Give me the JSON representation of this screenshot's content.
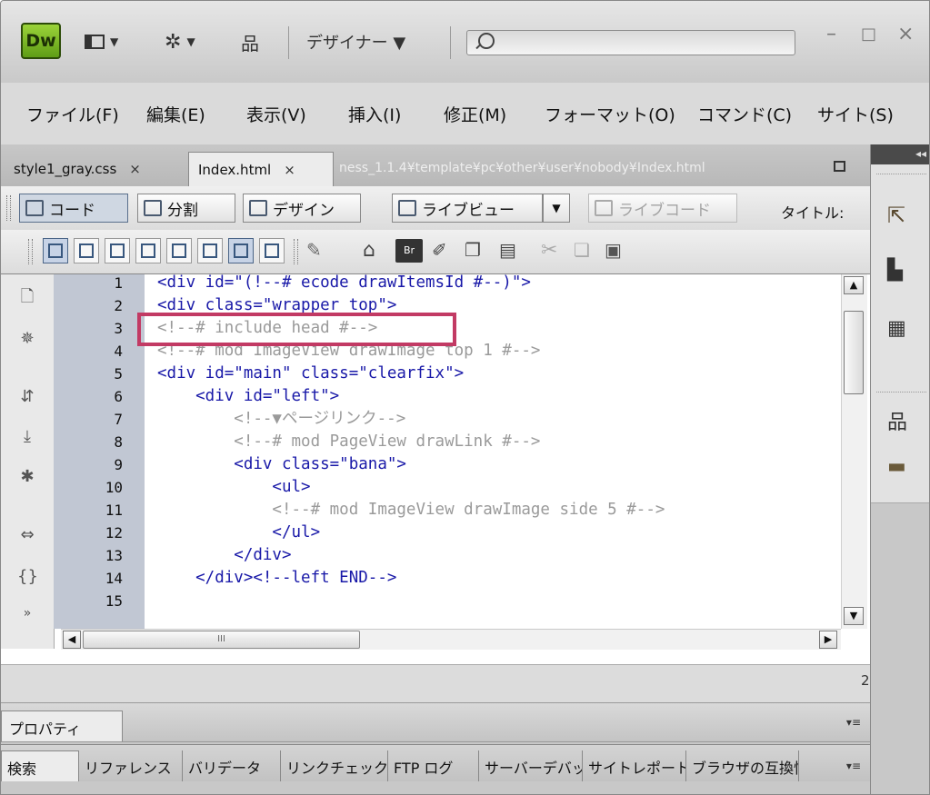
{
  "app": {
    "logo": "Dw",
    "workspace": "デザイナー ▼",
    "search_placeholder": ""
  },
  "window_controls": {
    "minimize": "–",
    "maximize": "□",
    "close": "×"
  },
  "colors": {
    "logo_green": "#7fbf27",
    "highlight_box": "#c23a64",
    "code_blue": "#1919a8",
    "comment_gray": "#9a9a9a",
    "gutter": "#c1c7d3"
  },
  "menu": [
    "ファイル(F)",
    "編集(E)",
    "表示(V)",
    "挿入(I)",
    "修正(M)",
    "フォーマット(O)",
    "コマンド(C)",
    "サイト(S)"
  ],
  "doc_tabs": {
    "inactive": "style1_gray.css",
    "active": "Index.html",
    "close": "×",
    "path": "ness_1.1.4¥template¥pc¥other¥user¥nobody¥Index.html"
  },
  "view_toolbar": {
    "code": "コード",
    "split": "分割",
    "design": "デザイン",
    "live_view": "ライブビュー",
    "live_code": "ライブコード",
    "title_label": "タイトル:"
  },
  "editor": {
    "line_numbers": [
      "1",
      "2",
      "3",
      "4",
      "5",
      "6",
      "7",
      "8",
      "9",
      "10",
      "11",
      "12",
      "13",
      "14",
      "15"
    ],
    "lines": [
      "<div id=\"(!--# ecode drawItemsId #--)\">",
      "<div class=\"wrapper top\">",
      "<!--# include head #-->",
      "<!--# mod ImageView drawImage top 1 #-->",
      "<div id=\"main\" class=\"clearfix\">",
      "    <div id=\"left\">",
      "        <!--▼ページリンク-->",
      "        <!--# mod PageView drawLink #-->",
      "        <div class=\"bana\">",
      "            <ul>",
      "            <!--# mod ImageView drawImage side 5 #-->",
      "            </ul>",
      "        </div>",
      "    </div><!--left END-->",
      ""
    ],
    "scroll_grip": "III"
  },
  "status": {
    "right_digit": "2"
  },
  "properties_tab": "プロパティ",
  "panel_menu": "▾≡",
  "bottom_tabs": [
    "検索",
    "リファレンス",
    "バリデータ",
    "リンクチェック",
    "FTP ログ",
    "サーバーデバッグ",
    "サイトレポート",
    "ブラウザの互換性"
  ],
  "right_panel": {
    "collapse": "◂◂"
  }
}
